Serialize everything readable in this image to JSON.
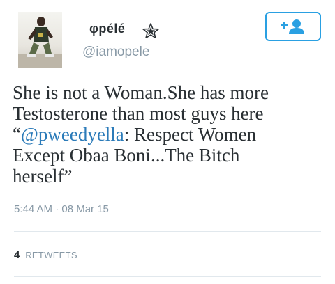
{
  "user": {
    "display_name": "φpélé",
    "handle": "@iamopele"
  },
  "icons": {
    "avatar": "profile-photo",
    "verified_star": "star-icon",
    "follow": "add-user-icon"
  },
  "tweet": {
    "line1": "She is not a Woman.She has more",
    "line2": "Testosterone than most guys here",
    "line3_open_quote": "“",
    "line3_mention": "@pweedyella",
    "line3_rest": ": Respect Women",
    "line4": "Except Obaa Boni...The Bitch",
    "line5": "herself”"
  },
  "meta": {
    "timestamp": "5:44 AM · 08 Mar 15"
  },
  "stats": {
    "retweet_count": "4",
    "retweet_label": "RETWEETS"
  },
  "colors": {
    "accent": "#2aa0e2",
    "mention": "#2b7bb9",
    "muted": "#8899a6",
    "text": "#292f33"
  }
}
